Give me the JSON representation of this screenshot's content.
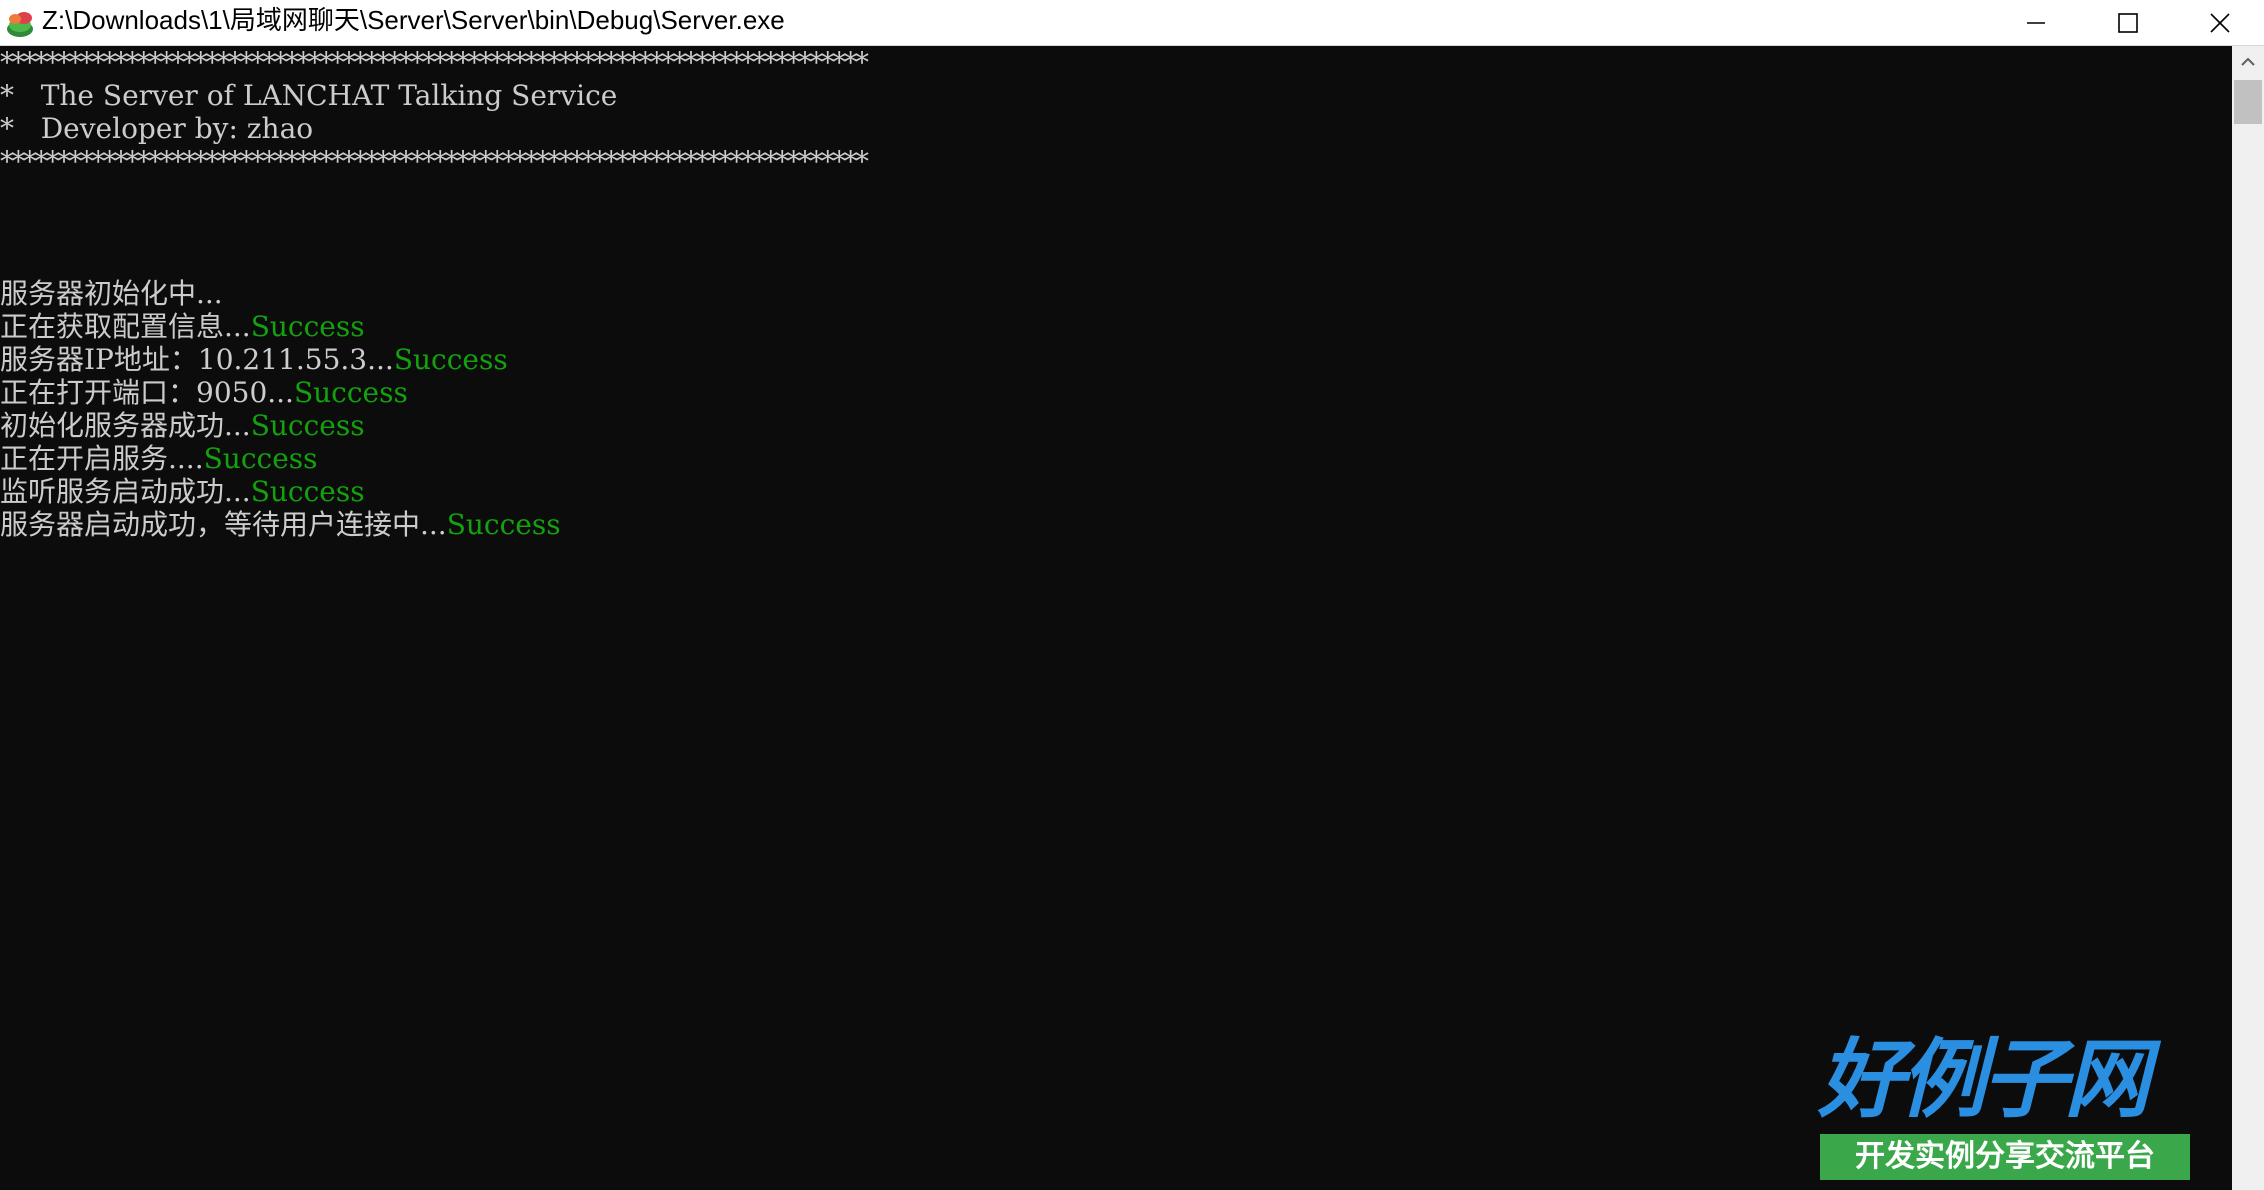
{
  "window": {
    "title": "Z:\\Downloads\\1\\局域网聊天\\Server\\Server\\bin\\Debug\\Server.exe",
    "icon": "console-app-icon",
    "controls": {
      "minimize": "minimize-icon",
      "maximize": "maximize-icon",
      "close": "close-icon"
    }
  },
  "console": {
    "colors": {
      "background": "#0c0c0c",
      "text": "#cccccc",
      "success": "#13a10e"
    },
    "banner": {
      "border": "****************************************************************************",
      "line1": "*   The Server of LANCHAT Talking Service",
      "line2": "*   Developer by: zhao"
    },
    "log": [
      {
        "text": "服务器初始化中...",
        "status": ""
      },
      {
        "text": "正在获取配置信息...",
        "status": "Success"
      },
      {
        "text": "服务器IP地址：10.211.55.3...",
        "status": "Success"
      },
      {
        "text": "正在打开端口：9050...",
        "status": "Success"
      },
      {
        "text": "初始化服务器成功...",
        "status": "Success"
      },
      {
        "text": "正在开启服务....",
        "status": "Success"
      },
      {
        "text": "监听服务启动成功...",
        "status": "Success"
      },
      {
        "text": "服务器启动成功，等待用户连接中...",
        "status": "Success"
      }
    ]
  },
  "watermark": {
    "logo_text": "好例子网",
    "tagline": "开发实例分享交流平台"
  }
}
